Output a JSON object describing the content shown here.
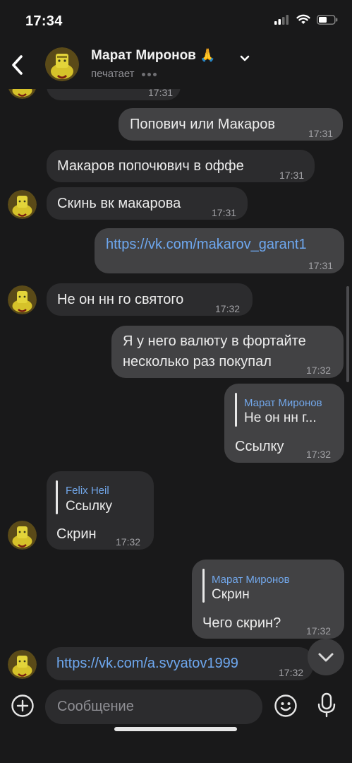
{
  "status_bar": {
    "time": "17:34"
  },
  "header": {
    "name": "Марат Миронов",
    "emoji": "🙏",
    "status": "печатает",
    "back_icon": "chevron-left-icon",
    "menu_icon": "chevron-down-icon"
  },
  "messages": [
    {
      "id": "m0",
      "direction": "in",
      "text": "",
      "time": "17:31"
    },
    {
      "id": "m1",
      "direction": "out",
      "text": "Попович или Макаров",
      "time": "17:31"
    },
    {
      "id": "m2",
      "direction": "in",
      "text": "Макаров попочювич в оффе",
      "time": "17:31"
    },
    {
      "id": "m3",
      "direction": "in",
      "text": "Скинь вк макарова",
      "time": "17:31"
    },
    {
      "id": "m4",
      "direction": "out",
      "text": "https://vk.com/makarov_garant1",
      "time": "17:31",
      "is_link": true
    },
    {
      "id": "m5",
      "direction": "in",
      "text": "Не он нн го святого",
      "time": "17:32"
    },
    {
      "id": "m6",
      "direction": "out",
      "text_lines": [
        "Я у него валюту в фортайте",
        "несколько раз покупал"
      ],
      "time": "17:32"
    },
    {
      "id": "m7",
      "direction": "out",
      "reply": {
        "name": "Марат Миронов",
        "text": "Не он нн г..."
      },
      "text": "Ссылку",
      "time": "17:32"
    },
    {
      "id": "m8",
      "direction": "in",
      "reply": {
        "name": "Felix Heil",
        "text": "Ссылку"
      },
      "text": "Скрин",
      "time": "17:32"
    },
    {
      "id": "m9",
      "direction": "out",
      "reply": {
        "name": "Марат Миронов",
        "text": "Скрин"
      },
      "text": "Чего скрин?",
      "time": "17:32"
    },
    {
      "id": "m10",
      "direction": "in",
      "text": "https://vk.com/a.svyatov1999",
      "time": "17:32",
      "is_link": true
    }
  ],
  "composer": {
    "placeholder": "Сообщение"
  },
  "colors": {
    "background": "#19191a",
    "incoming_bubble": "#2c2c2e",
    "outgoing_bubble": "#424244",
    "link": "#6ea8f0",
    "reply_name": "#72a7ea"
  }
}
